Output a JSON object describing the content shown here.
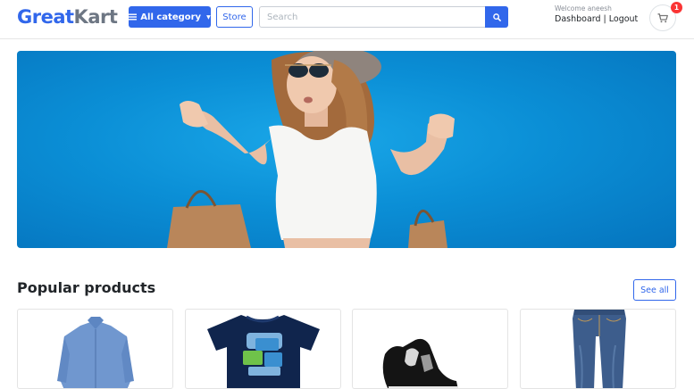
{
  "header": {
    "logo_part1": "Great",
    "logo_part2": "Kart",
    "all_category_label": "All category",
    "store_label": "Store",
    "search_placeholder": "Search",
    "welcome_text": "Welcome aneesh",
    "dashboard_label": "Dashboard",
    "separator": "|",
    "logout_label": "Logout",
    "cart_count": "1"
  },
  "banner": {
    "image": "woman-with-shopping-bags"
  },
  "popular": {
    "title": "Popular products",
    "see_all_label": "See all",
    "products": [
      {
        "image": "blue-shirt"
      },
      {
        "image": "navy-graphic-tshirt"
      },
      {
        "image": "black-sneaker"
      },
      {
        "image": "blue-jeans"
      }
    ]
  },
  "colors": {
    "brand_blue": "#3167eb",
    "logo_gray": "#6d7683",
    "badge_red": "#fa3434"
  }
}
